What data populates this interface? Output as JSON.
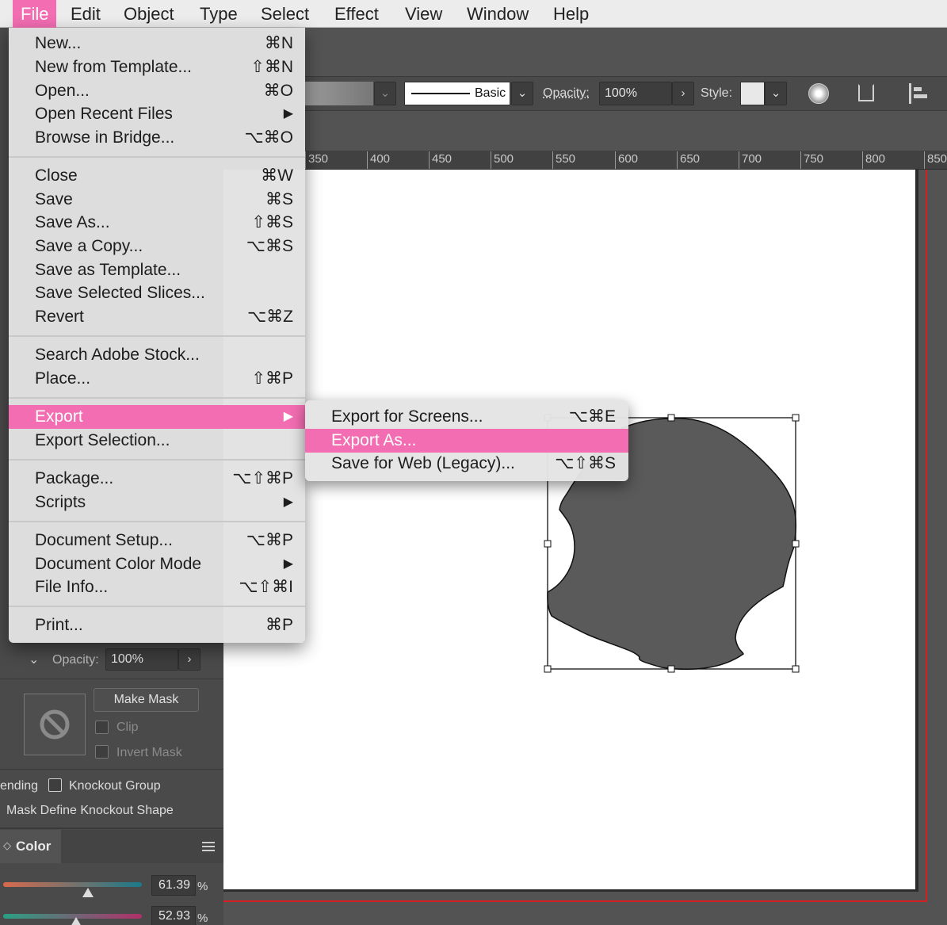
{
  "menubar": {
    "items": [
      "File",
      "Edit",
      "Object",
      "Type",
      "Select",
      "Effect",
      "View",
      "Window",
      "Help"
    ]
  },
  "controlbar": {
    "stroke_profile": "Basic",
    "opacity_label": "Opacity:",
    "opacity_value": "100%",
    "style_label": "Style:"
  },
  "ruler": {
    "ticks": [
      "350",
      "400",
      "450",
      "500",
      "550",
      "600",
      "650",
      "700",
      "750",
      "800",
      "850"
    ]
  },
  "file_menu": {
    "items": [
      {
        "label": "New...",
        "shortcut": "⌘N"
      },
      {
        "label": "New from Template...",
        "shortcut": "⇧⌘N"
      },
      {
        "label": "Open...",
        "shortcut": "⌘O"
      },
      {
        "label": "Open Recent Files",
        "shortcut": "▶"
      },
      {
        "label": "Browse in Bridge...",
        "shortcut": "⌥⌘O"
      },
      {
        "label": "Close",
        "shortcut": "⌘W"
      },
      {
        "label": "Save",
        "shortcut": "⌘S"
      },
      {
        "label": "Save As...",
        "shortcut": "⇧⌘S"
      },
      {
        "label": "Save a Copy...",
        "shortcut": "⌥⌘S"
      },
      {
        "label": "Save as Template...",
        "shortcut": ""
      },
      {
        "label": "Save Selected Slices...",
        "shortcut": ""
      },
      {
        "label": "Revert",
        "shortcut": "⌥⌘Z"
      },
      {
        "label": "Search Adobe Stock...",
        "shortcut": ""
      },
      {
        "label": "Place...",
        "shortcut": "⇧⌘P"
      },
      {
        "label": "Export",
        "shortcut": "▶"
      },
      {
        "label": "Export Selection...",
        "shortcut": ""
      },
      {
        "label": "Package...",
        "shortcut": "⌥⇧⌘P"
      },
      {
        "label": "Scripts",
        "shortcut": "▶"
      },
      {
        "label": "Document Setup...",
        "shortcut": "⌥⌘P"
      },
      {
        "label": "Document Color Mode",
        "shortcut": "▶"
      },
      {
        "label": "File Info...",
        "shortcut": "⌥⇧⌘I"
      },
      {
        "label": "Print...",
        "shortcut": "⌘P"
      }
    ]
  },
  "export_submenu": {
    "items": [
      {
        "label": "Export for Screens...",
        "shortcut": "⌥⌘E"
      },
      {
        "label": "Export As...",
        "shortcut": ""
      },
      {
        "label": "Save for Web (Legacy)...",
        "shortcut": "⌥⇧⌘S"
      }
    ]
  },
  "transparency_panel": {
    "opacity_label": "Opacity:",
    "opacity_value": "100%",
    "make_mask": "Make Mask",
    "clip": "Clip",
    "invert_mask": "Invert Mask",
    "isolate_blending": "ending",
    "knockout_group": "Knockout Group",
    "opacity_mask": "Mask Define Knockout Shape"
  },
  "color_panel": {
    "tab_label": "Color",
    "values": [
      "61.39",
      "52.93"
    ],
    "unit": "%"
  },
  "colors": {
    "highlight": "#f26db2",
    "shape_fill": "#5a5a5a",
    "bleed": "#d62020"
  }
}
